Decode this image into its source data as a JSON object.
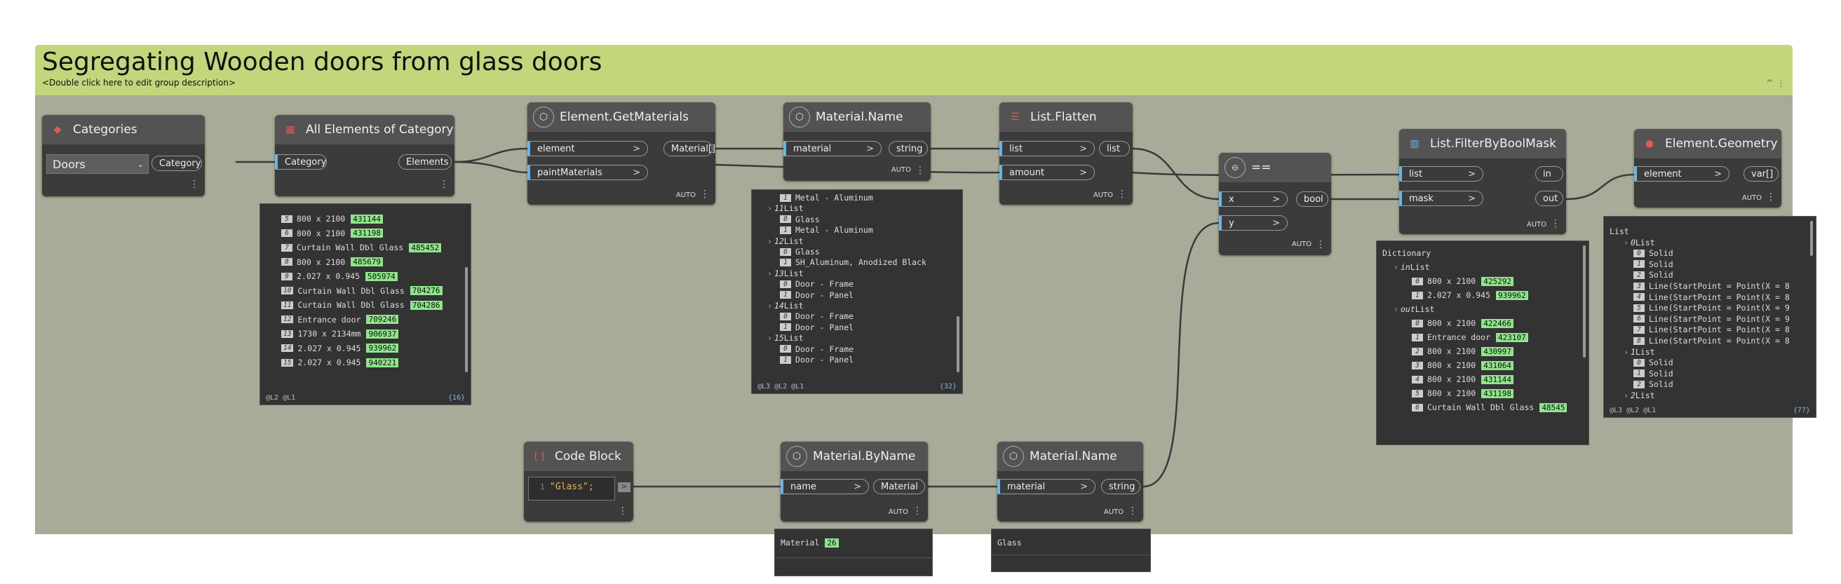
{
  "group": {
    "title": "Segregating Wooden doors from glass doors",
    "description": "<Double click here to edit group description>",
    "collapse": "^ ⋮"
  },
  "nodes": {
    "categories": {
      "title": "Categories",
      "selected": "Doors",
      "output": "Category"
    },
    "all_elements": {
      "title": "All Elements of Category",
      "input": "Category",
      "output": "Elements"
    },
    "get_materials": {
      "title": "Element.GetMaterials",
      "inputs": [
        "element",
        "paintMaterials"
      ],
      "output": "Material[]",
      "lacing": "AUTO"
    },
    "material_name_1": {
      "title": "Material.Name",
      "input": "material",
      "output": "string",
      "lacing": "AUTO"
    },
    "list_flatten": {
      "title": "List.Flatten",
      "inputs": [
        "list",
        "amount"
      ],
      "output": "list",
      "lacing": "AUTO"
    },
    "equals": {
      "title": "==",
      "inputs": [
        "x",
        "y"
      ],
      "output": "bool",
      "lacing": "AUTO"
    },
    "filter_mask": {
      "title": "List.FilterByBoolMask",
      "inputs": [
        "list",
        "mask"
      ],
      "outputs": [
        "in",
        "out"
      ],
      "lacing": "AUTO"
    },
    "element_geometry": {
      "title": "Element.Geometry",
      "input": "element",
      "output": "var[]",
      "lacing": "AUTO"
    },
    "code_block": {
      "title": "Code Block",
      "line_no": "1",
      "code": "\"Glass\";"
    },
    "material_byname": {
      "title": "Material.ByName",
      "input": "name",
      "output": "Material",
      "lacing": "AUTO"
    },
    "material_name_2": {
      "title": "Material.Name",
      "input": "material",
      "output": "string",
      "lacing": "AUTO"
    }
  },
  "previews": {
    "all_elements": {
      "rows": [
        {
          "i": "5",
          "t": "800 x 2100",
          "id": "431144"
        },
        {
          "i": "6",
          "t": "800 x 2100",
          "id": "431198"
        },
        {
          "i": "7",
          "t": "Curtain Wall Dbl Glass",
          "id": "485452"
        },
        {
          "i": "8",
          "t": "800 x 2100",
          "id": "485679"
        },
        {
          "i": "9",
          "t": "2.027 x 0.945",
          "id": "505974"
        },
        {
          "i": "10",
          "t": "Curtain Wall Dbl Glass",
          "id": "704276"
        },
        {
          "i": "11",
          "t": "Curtain Wall Dbl Glass",
          "id": "704286"
        },
        {
          "i": "12",
          "t": "Entrance door",
          "id": "709246"
        },
        {
          "i": "13",
          "t": "1730 x 2134mm",
          "id": "906937"
        },
        {
          "i": "14",
          "t": "2.027 x 0.945",
          "id": "939962"
        },
        {
          "i": "15",
          "t": "2.027 x 0.945",
          "id": "940221"
        }
      ],
      "levels": "@L2 @L1",
      "count": "{16}"
    },
    "material_name_1": {
      "rows": [
        {
          "k": "item",
          "i": "1",
          "t": "Metal - Aluminum"
        },
        {
          "k": "list",
          "i": "11",
          "t": "List"
        },
        {
          "k": "item",
          "i": "0",
          "t": "Glass"
        },
        {
          "k": "item",
          "i": "1",
          "t": "Metal - Aluminum"
        },
        {
          "k": "list",
          "i": "12",
          "t": "List"
        },
        {
          "k": "item",
          "i": "0",
          "t": "Glass"
        },
        {
          "k": "item",
          "i": "1",
          "t": "SH_Aluminum, Anodized Black"
        },
        {
          "k": "list",
          "i": "13",
          "t": "List"
        },
        {
          "k": "item",
          "i": "0",
          "t": "Door - Frame"
        },
        {
          "k": "item",
          "i": "1",
          "t": "Door - Panel"
        },
        {
          "k": "list",
          "i": "14",
          "t": "List"
        },
        {
          "k": "item",
          "i": "0",
          "t": "Door - Frame"
        },
        {
          "k": "item",
          "i": "1",
          "t": "Door - Panel"
        },
        {
          "k": "list",
          "i": "15",
          "t": "List"
        },
        {
          "k": "item",
          "i": "0",
          "t": "Door - Frame"
        },
        {
          "k": "item",
          "i": "1",
          "t": "Door - Panel"
        }
      ],
      "levels": "@L3 @L2 @L1",
      "count": "{32}"
    },
    "filter_mask": {
      "rows": [
        {
          "k": "head",
          "t": "Dictionary"
        },
        {
          "k": "list",
          "i": "in",
          "t": "List"
        },
        {
          "k": "item",
          "i": "0",
          "t": "800 x 2100",
          "id": "425292"
        },
        {
          "k": "item",
          "i": "1",
          "t": "2.027 x 0.945",
          "id": "939962"
        },
        {
          "k": "list",
          "i": "out",
          "t": "List"
        },
        {
          "k": "item",
          "i": "0",
          "t": "800 x 2100",
          "id": "422466"
        },
        {
          "k": "item",
          "i": "1",
          "t": "Entrance door",
          "id": "423107"
        },
        {
          "k": "item",
          "i": "2",
          "t": "800 x 2100",
          "id": "430997"
        },
        {
          "k": "item",
          "i": "3",
          "t": "800 x 2100",
          "id": "431064"
        },
        {
          "k": "item",
          "i": "4",
          "t": "800 x 2100",
          "id": "431144"
        },
        {
          "k": "item",
          "i": "5",
          "t": "800 x 2100",
          "id": "431198"
        },
        {
          "k": "item",
          "i": "6",
          "t": "Curtain Wall Dbl Glass",
          "id": "48545"
        }
      ]
    },
    "element_geometry": {
      "rows": [
        {
          "k": "head",
          "t": "List"
        },
        {
          "k": "list",
          "i": "0",
          "t": "List"
        },
        {
          "k": "item",
          "i": "0",
          "t": "Solid"
        },
        {
          "k": "item",
          "i": "1",
          "t": "Solid"
        },
        {
          "k": "item",
          "i": "2",
          "t": "Solid"
        },
        {
          "k": "item",
          "i": "3",
          "t": "Line(StartPoint = Point(X = 8"
        },
        {
          "k": "item",
          "i": "4",
          "t": "Line(StartPoint = Point(X = 8"
        },
        {
          "k": "item",
          "i": "5",
          "t": "Line(StartPoint = Point(X = 9"
        },
        {
          "k": "item",
          "i": "6",
          "t": "Line(StartPoint = Point(X = 9"
        },
        {
          "k": "item",
          "i": "7",
          "t": "Line(StartPoint = Point(X = 8"
        },
        {
          "k": "item",
          "i": "8",
          "t": "Line(StartPoint = Point(X = 8"
        },
        {
          "k": "list",
          "i": "1",
          "t": "List"
        },
        {
          "k": "item",
          "i": "0",
          "t": "Solid"
        },
        {
          "k": "item",
          "i": "1",
          "t": "Solid"
        },
        {
          "k": "item",
          "i": "2",
          "t": "Solid"
        },
        {
          "k": "list",
          "i": "2",
          "t": "List"
        }
      ],
      "levels": "@L3 @L2 @L1",
      "count": "{77}"
    },
    "material_byname": {
      "label": "Material",
      "id": "26"
    },
    "material_name_2": {
      "value": "Glass"
    }
  },
  "colors": {
    "group_header": "#c2d67b",
    "group_body": "#a9ab98",
    "node": "#3b3b3b",
    "wire": "#3a3a3a",
    "port_accent": "#68b5e6",
    "id_badge": "#8fe68a"
  }
}
